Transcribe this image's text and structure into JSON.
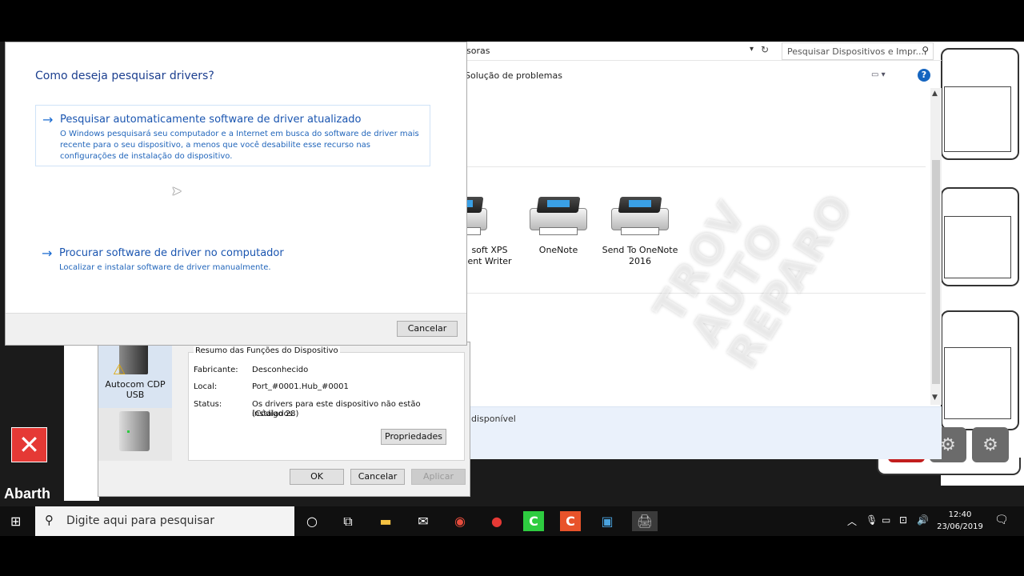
{
  "update_dialog": {
    "title_fragment": "",
    "question": "Como deseja pesquisar drivers?",
    "option_auto": {
      "title": "Pesquisar automaticamente software de driver atualizado",
      "description": "O Windows pesquisará seu computador e a Internet em busca do software de driver mais recente para o seu dispositivo, a menos que você desabilite esse recurso nas configurações de instalação do dispositivo."
    },
    "option_manual": {
      "title": "Procurar software de driver no computador",
      "description": "Localizar e instalar software de driver manualmente."
    },
    "cancel_label": "Cancelar"
  },
  "devices_window": {
    "address_text": "soras",
    "search_placeholder": "Pesquisar Dispositivos e Impr...",
    "troubleshoot_label": "Solução de problemas",
    "devices": [
      {
        "label_line1": "soft XPS",
        "label_line2": "ent Writer"
      },
      {
        "label_line1": "OneNote",
        "label_line2": ""
      },
      {
        "label_line1": "Send To OneNote",
        "label_line2": "2016"
      }
    ],
    "status_text": "disponível"
  },
  "properties_dialog": {
    "device1_line1": "Autocom CDP",
    "device1_line2": "USB",
    "group_title": "Resumo das Funções do Dispositivo",
    "manufacturer_label": "Fabricante:",
    "manufacturer_value": "Desconhecido",
    "location_label": "Local:",
    "location_value": "Port_#0001.Hub_#0001",
    "status_label": "Status:",
    "status_value_line1": "Os drivers para este dispositivo não estão instalados.",
    "status_value_line2": "(Código 28)",
    "properties_button": "Propriedades",
    "ok_button": "OK",
    "cancel_button": "Cancelar",
    "apply_button": "Aplicar"
  },
  "watermark": {
    "line1": "TROV",
    "line2": "AUTO",
    "line3": "REPARO"
  },
  "app_label": "Abarth",
  "taskbar": {
    "search_placeholder": "Digite aqui para pesquisar",
    "time": "12:40",
    "date": "23/06/2019"
  }
}
